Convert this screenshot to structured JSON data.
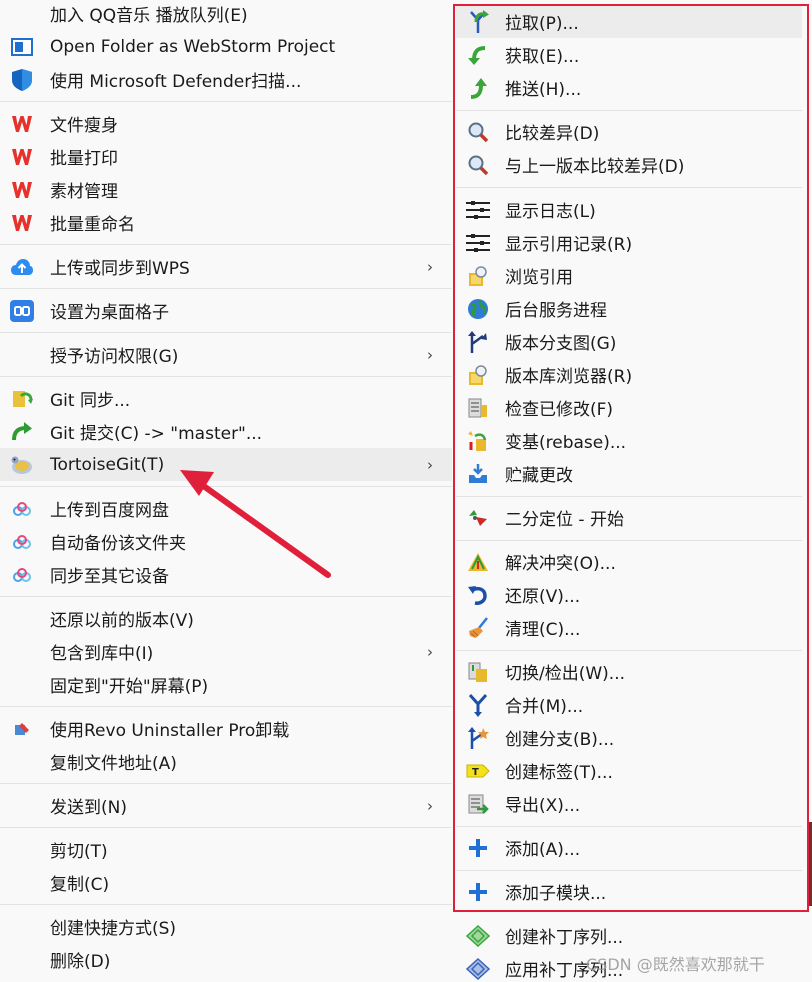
{
  "left_menu": {
    "items": [
      {
        "label": "加入 QQ音乐 播放队列(E)",
        "icon": "none"
      },
      {
        "label": "Open Folder as WebStorm Project",
        "icon": "webstorm-icon"
      },
      {
        "label": "使用 Microsoft Defender扫描...",
        "icon": "defender-shield-icon"
      },
      {
        "label": "文件瘦身",
        "icon": "wps-icon"
      },
      {
        "label": "批量打印",
        "icon": "wps-icon"
      },
      {
        "label": "素材管理",
        "icon": "wps-icon"
      },
      {
        "label": "批量重命名",
        "icon": "wps-icon"
      },
      {
        "label": "上传或同步到WPS",
        "icon": "cloud-upload-icon",
        "submenu": true
      },
      {
        "label": "设置为桌面格子",
        "icon": "desktop-grid-icon"
      },
      {
        "label": "授予访问权限(G)",
        "icon": "none",
        "submenu": true
      },
      {
        "label": "Git 同步...",
        "icon": "git-sync-icon"
      },
      {
        "label": "Git 提交(C) -> \"master\"...",
        "icon": "git-commit-icon"
      },
      {
        "label": "TortoiseGit(T)",
        "icon": "tortoisegit-icon",
        "submenu": true,
        "highlighted": true
      },
      {
        "label": "上传到百度网盘",
        "icon": "baidu-netdisk-icon"
      },
      {
        "label": "自动备份该文件夹",
        "icon": "baidu-netdisk-icon"
      },
      {
        "label": "同步至其它设备",
        "icon": "baidu-netdisk-icon"
      },
      {
        "label": "还原以前的版本(V)",
        "icon": "none"
      },
      {
        "label": "包含到库中(I)",
        "icon": "none",
        "submenu": true
      },
      {
        "label": "固定到\"开始\"屏幕(P)",
        "icon": "none"
      },
      {
        "label": "使用Revo Uninstaller Pro卸载",
        "icon": "revo-uninstaller-icon"
      },
      {
        "label": "复制文件地址(A)",
        "icon": "none"
      },
      {
        "label": "发送到(N)",
        "icon": "none",
        "submenu": true
      },
      {
        "label": "剪切(T)",
        "icon": "none"
      },
      {
        "label": "复制(C)",
        "icon": "none"
      },
      {
        "label": "创建快捷方式(S)",
        "icon": "none"
      },
      {
        "label": "删除(D)",
        "icon": "none"
      }
    ],
    "submenu_arrow": "›"
  },
  "tortoisegit_menu": {
    "items": [
      {
        "label": "拉取(P)...",
        "icon": "pull-icon"
      },
      {
        "label": "获取(E)...",
        "icon": "fetch-icon"
      },
      {
        "label": "推送(H)...",
        "icon": "push-icon"
      },
      {
        "label": "比较差异(D)",
        "icon": "diff-magnifier-icon"
      },
      {
        "label": "与上一版本比较差异(D)",
        "icon": "diff-magnifier-icon"
      },
      {
        "label": "显示日志(L)",
        "icon": "log-icon"
      },
      {
        "label": "显示引用记录(R)",
        "icon": "reflog-icon"
      },
      {
        "label": "浏览引用",
        "icon": "browse-refs-icon"
      },
      {
        "label": "后台服务进程",
        "icon": "daemon-globe-icon"
      },
      {
        "label": "版本分支图(G)",
        "icon": "revision-graph-icon"
      },
      {
        "label": "版本库浏览器(R)",
        "icon": "repo-browser-icon"
      },
      {
        "label": "检查已修改(F)",
        "icon": "check-modifications-icon"
      },
      {
        "label": "变基(rebase)...",
        "icon": "rebase-icon"
      },
      {
        "label": "贮藏更改",
        "icon": "stash-icon"
      },
      {
        "label": "二分定位 - 开始",
        "icon": "bisect-icon"
      },
      {
        "label": "解决冲突(O)...",
        "icon": "resolve-conflict-icon"
      },
      {
        "label": "还原(V)...",
        "icon": "revert-icon"
      },
      {
        "label": "清理(C)...",
        "icon": "cleanup-broom-icon"
      },
      {
        "label": "切换/检出(W)...",
        "icon": "switch-checkout-icon"
      },
      {
        "label": "合并(M)...",
        "icon": "merge-icon"
      },
      {
        "label": "创建分支(B)...",
        "icon": "create-branch-icon"
      },
      {
        "label": "创建标签(T)...",
        "icon": "create-tag-icon"
      },
      {
        "label": "导出(X)...",
        "icon": "export-icon"
      },
      {
        "label": "添加(A)...",
        "icon": "add-plus-icon"
      },
      {
        "label": "添加子模块...",
        "icon": "add-plus-icon"
      },
      {
        "label": "创建补丁序列...",
        "icon": "create-patch-icon"
      },
      {
        "label": "应用补丁序列...",
        "icon": "apply-patch-icon"
      }
    ]
  },
  "annotation": {
    "highlight_color": "#e0203a"
  },
  "watermark": {
    "text": "CSDN @既然喜欢那就干"
  }
}
